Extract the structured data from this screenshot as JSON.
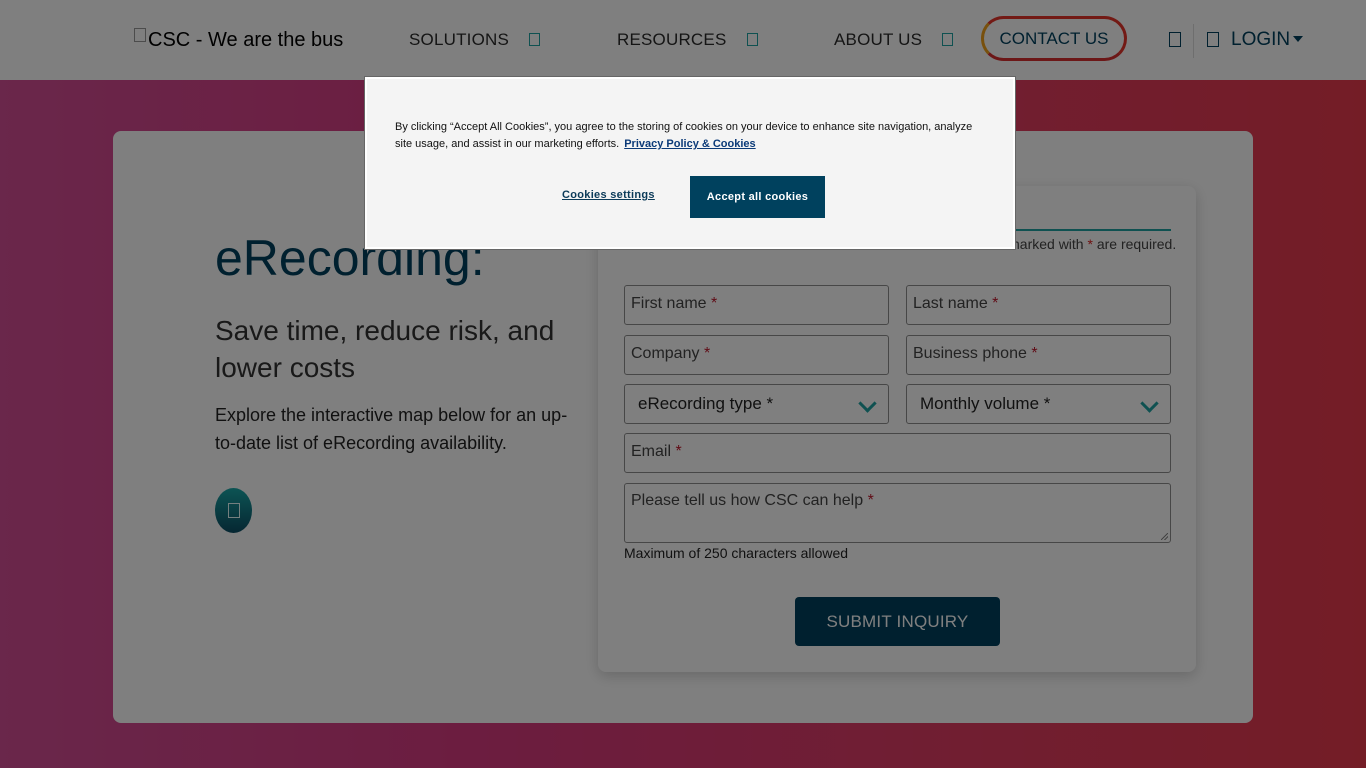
{
  "header": {
    "logo_alt": "CSC - We are the bus",
    "nav": [
      {
        "label": "SOLUTIONS"
      },
      {
        "label": "RESOURCES"
      },
      {
        "label": "ABOUT US"
      }
    ],
    "contact_label": "CONTACT US",
    "login_label": "LOGIN"
  },
  "hero": {
    "title": "eRecording:",
    "subtitle": "Save time, reduce risk, and lower costs",
    "text": "Explore the interactive map below for an up-to-date list of eRecording availability."
  },
  "form": {
    "required_note": "narked with ",
    "required_star": "*",
    "required_note_end": " are required.",
    "first_name": "First name",
    "last_name": "Last name",
    "company": "Company",
    "business_phone": "Business phone",
    "erecording_type": "eRecording type *",
    "monthly_volume": "Monthly volume *",
    "email": "Email",
    "help_placeholder": "Please tell us how CSC can help",
    "star": "*",
    "max_note": "Maximum of 250 characters allowed",
    "submit_label": "SUBMIT INQUIRY"
  },
  "cookie_banner": {
    "text": "By clicking “Accept All Cookies”, you agree to the storing of cookies on your device to enhance site navigation, analyze site usage, and assist in our marketing efforts.",
    "privacy_link": "Privacy Policy & Cookies",
    "settings_label": "Cookies settings",
    "accept_label": "Accept all cookies"
  },
  "colors": {
    "brand_navy": "#00415e",
    "accent_teal": "#1fa3a3",
    "background_gradient_start": "#d44e96",
    "background_gradient_end": "#e83a4d"
  }
}
